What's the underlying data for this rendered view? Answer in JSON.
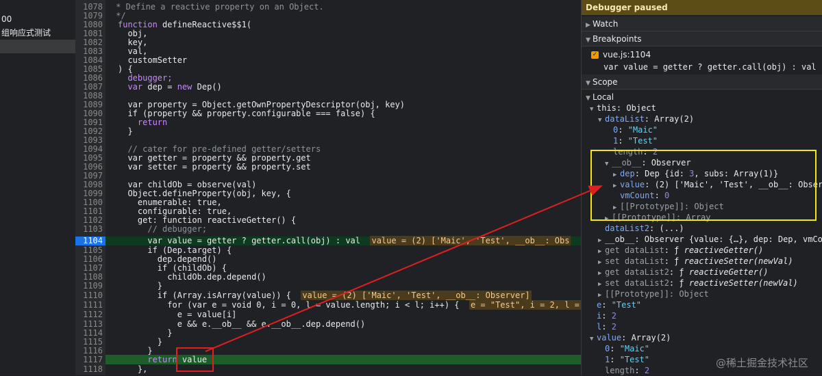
{
  "left": {
    "items": [
      "00",
      "组响应式测试",
      ""
    ]
  },
  "gutter": {
    "lines": [
      "1078",
      "1079",
      "1080",
      "1081",
      "1082",
      "1083",
      "1084",
      "1085",
      "1086",
      "1087",
      "1088",
      "1089",
      "1090",
      "1091",
      "1092",
      "1093",
      "1094",
      "1095",
      "1096",
      "1097",
      "1098",
      "1099",
      "1100",
      "1101",
      "1102",
      "1103",
      "1104",
      "1105",
      "1106",
      "1107",
      "1108",
      "1109",
      "1110",
      "1111",
      "1112",
      "1113",
      "1114",
      "1115",
      "1116",
      "1117",
      "1118"
    ]
  },
  "code": {
    "l1078": " * Define a reactive property on an Object.",
    "l1079": " */",
    "l1080_fn": "function",
    "l1080_rest": " defineReactive$$1(",
    "l1081": "  obj,",
    "l1082": "  key,",
    "l1083": "  val,",
    "l1084": "  customSetter",
    "l1085": ") {",
    "l1086": "  debugger;",
    "l1087_a": "  var",
    "l1087_b": " dep = ",
    "l1087_c": "new",
    "l1087_d": " Dep()",
    "l1089": "  var property = Object.getOwnPropertyDescriptor(obj, key)",
    "l1090": "  if (property && property.configurable === false) {",
    "l1091": "    return",
    "l1092": "  }",
    "l1094": "  // cater for pre-defined getter/setters",
    "l1095": "  var getter = property && property.get",
    "l1096": "  var setter = property && property.set",
    "l1098": "  var childOb = observe(val)",
    "l1099": "  Object.defineProperty(obj, key, {",
    "l1100": "    enumerable: true,",
    "l1101": "    configurable: true,",
    "l1102": "    get: function reactiveGetter() {",
    "l1103": "      // debugger;",
    "l1104": "      var value = getter ? getter.call(obj) : val",
    "l1104_inline": "value = (2) ['Maic', 'Test', __ob__: Obs",
    "l1105": "      if (Dep.target) {",
    "l1106": "        dep.depend()",
    "l1107": "        if (childOb) {",
    "l1108": "          childOb.dep.depend()",
    "l1109": "        }",
    "l1110": "        if (Array.isArray(value)) {",
    "l1110_inline": "value = (2) ['Maic', 'Test', __ob__: Observer]",
    "l1111": "          for (var e = void 0, i = 0, l = value.length; i < l; i++) {",
    "l1111_inline": "e = \"Test\", i = 2, l =",
    "l1112": "            e = value[i]",
    "l1113": "            e && e.__ob__ && e.__ob__.dep.depend()",
    "l1114": "          }",
    "l1115": "        }",
    "l1116": "      }",
    "l1117_kw": "      return",
    "l1117_val": " value",
    "l1118": "    },"
  },
  "panel": {
    "paused": "Debugger paused",
    "watch": "Watch",
    "breakpoints": "Breakpoints",
    "bp_file": "vue.js:1104",
    "bp_code": "var value = getter ? getter.call(obj) : val",
    "scope": "Scope",
    "local": "Local",
    "rows": {
      "this_k": "this",
      "this_v": ": Object",
      "dataList_k": "dataList",
      "dataList_v": ": Array(2)",
      "d0_k": "0",
      "d0_v": "\"Maic\"",
      "d1_k": "1",
      "d1_v": "\"Test\"",
      "len_k": "length",
      "len_v": "2",
      "ob_k": "__ob__",
      "ob_v": ": Observer",
      "dep_k": "dep",
      "dep_v": ": Dep {id: ",
      "dep_id": "3",
      "dep_v2": ", subs: Array(1)}",
      "value_k": "value",
      "value_v": ": (2) ['Maic', 'Test', __ob__: Obser",
      "vmCount_k": "vmCount",
      "vmCount_v": "0",
      "proto1": "[[Prototype]]: Object",
      "proto2": "[[Prototype]]: Array",
      "dataList2_k": "dataList2",
      "dataList2_v": ": (...)",
      "ob2": "__ob__: Observer {value: {…}, dep: Dep, vmCo",
      "get1_pre": "get dataList",
      "get1_f": ": ƒ ",
      "get1_fn": "reactiveGetter()",
      "set1_pre": "set dataList",
      "set1_f": ": ƒ ",
      "set1_fn": "reactiveSetter(newVal)",
      "get2_pre": "get dataList2",
      "get2_f": ": ƒ ",
      "get2_fn": "reactiveGetter()",
      "set2_pre": "set dataList2",
      "set2_f": ": ƒ ",
      "set2_fn": "reactiveSetter(newVal)",
      "proto3": "[[Prototype]]: Object",
      "e_k": "e",
      "e_v": "\"Test\"",
      "i_k": "i",
      "i_v": "2",
      "l_k": "l",
      "l_v": "2",
      "v_k": "value",
      "v_v": ": Array(2)",
      "v0_k": "0",
      "v0_v": "\"Maic\"",
      "v1_k": "1",
      "v1_v": "\"Test\"",
      "vlen_k": "length",
      "vlen_v": "2"
    }
  },
  "watermark": "@稀土掘金技术社区",
  "colors": {
    "highlight_box": "#f5e616",
    "arrow": "#e02020"
  }
}
